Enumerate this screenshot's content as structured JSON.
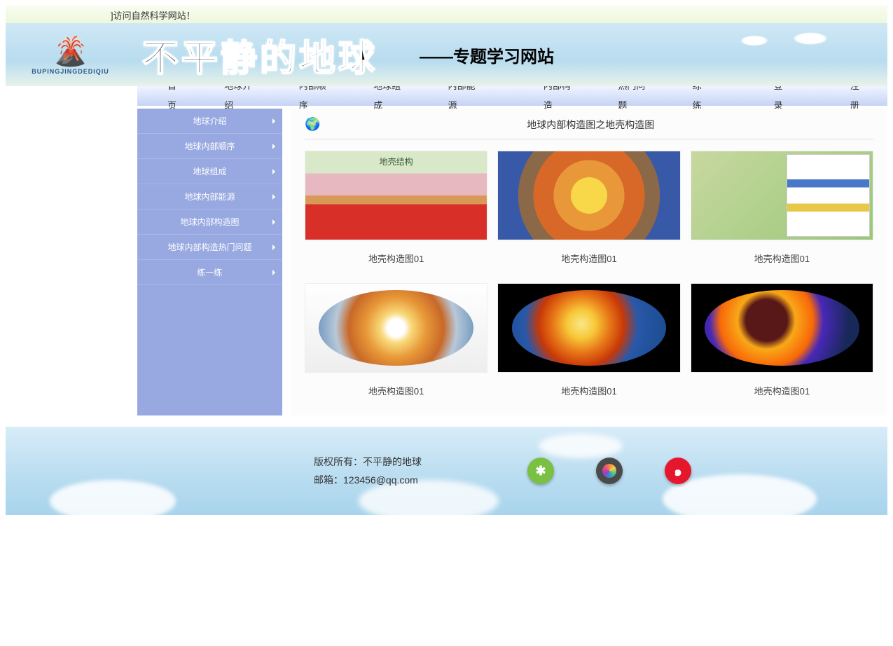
{
  "marquee": "]访问自然科学网站！",
  "header": {
    "logo_text": "BUPINGJINGDEDIQIU",
    "title": "不平静的地球",
    "subtitle": "——专题学习网站"
  },
  "nav": [
    "首页",
    "地球介绍",
    "内部顺序",
    "地球组成",
    "内部能源",
    "内部构造",
    "热门问题",
    "练一练",
    "登录",
    "注册"
  ],
  "sidebar": [
    "地球介绍",
    "地球内部顺序",
    "地球组成",
    "地球内部能源",
    "地球内部构造图",
    "地球内部构造热门问题",
    "练一练"
  ],
  "content": {
    "title": "地球内部构造图之地壳构造图",
    "items": [
      {
        "caption": "地壳构造图01"
      },
      {
        "caption": "地壳构造图01"
      },
      {
        "caption": "地壳构造图01"
      },
      {
        "caption": "地壳构造图01"
      },
      {
        "caption": "地壳构造图01"
      },
      {
        "caption": "地壳构造图01"
      }
    ]
  },
  "footer": {
    "copyright": "版权所有：不平静的地球",
    "email": "邮箱：123456@qq.com"
  }
}
